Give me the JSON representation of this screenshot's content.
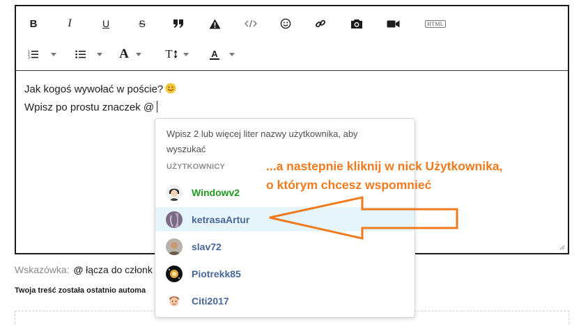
{
  "toolbar": {
    "row1": [
      {
        "name": "bold-icon",
        "glyph": "B"
      },
      {
        "name": "italic-icon",
        "glyph": "I"
      },
      {
        "name": "underline-icon",
        "glyph": "U"
      },
      {
        "name": "strikethrough-icon",
        "glyph": "S"
      },
      {
        "name": "quote-icon",
        "glyph": "quote"
      },
      {
        "name": "spoiler-warning-icon",
        "glyph": "warning"
      },
      {
        "name": "code-icon",
        "glyph": "</>"
      },
      {
        "name": "smiley-icon",
        "glyph": "smiley"
      },
      {
        "name": "link-icon",
        "glyph": "link"
      },
      {
        "name": "camera-icon",
        "glyph": "camera"
      },
      {
        "name": "video-icon",
        "glyph": "video"
      },
      {
        "name": "html-icon",
        "glyph": "HTML"
      }
    ],
    "row2": [
      {
        "name": "ordered-list-icon",
        "dropdown": true
      },
      {
        "name": "unordered-list-icon",
        "dropdown": true
      },
      {
        "name": "font-family-icon",
        "glyph": "A",
        "dropdown": true
      },
      {
        "name": "font-size-icon",
        "glyph": "TI",
        "dropdown": true
      },
      {
        "name": "text-color-icon",
        "glyph": "A",
        "dropdown": true
      }
    ],
    "html_label": "HTML",
    "font_glyph": "A",
    "size_glyph": "T",
    "color_glyph": "A"
  },
  "editor": {
    "line1": "Jak kogoś wywołać w poście?",
    "line2": "Wpisz po prostu  znaczek @",
    "emoji": "smiley-face-icon"
  },
  "mention": {
    "instructions": "Wpisz 2 lub więcej liter nazwy użytkownika, aby wyszukać",
    "heading": "UŻYTKOWNICY",
    "users": [
      {
        "name": "Windowv2",
        "color": "#1e9a1e",
        "active": false
      },
      {
        "name": "ketrasaArtur",
        "color": "#47679a",
        "active": true
      },
      {
        "name": "slav72",
        "color": "#47679a",
        "active": false
      },
      {
        "name": "Piotrekk85",
        "color": "#47679a",
        "active": false
      },
      {
        "name": "Citi2017",
        "color": "#47679a",
        "active": false
      }
    ]
  },
  "hint": {
    "label": "Wskazówka:",
    "at": "@",
    "rest": "łącza do członk"
  },
  "autosave": "Twoja treść została ostatnio automa",
  "annotation": {
    "line1": "...a nastepnie kliknij w nick Użytkownika,",
    "line2": "o którym chcesz wspomnieć"
  },
  "colors": {
    "annotation": "#f07b1e",
    "link": "#47679a",
    "online_user": "#1e9a1e",
    "active_row": "#e6f4fb"
  }
}
